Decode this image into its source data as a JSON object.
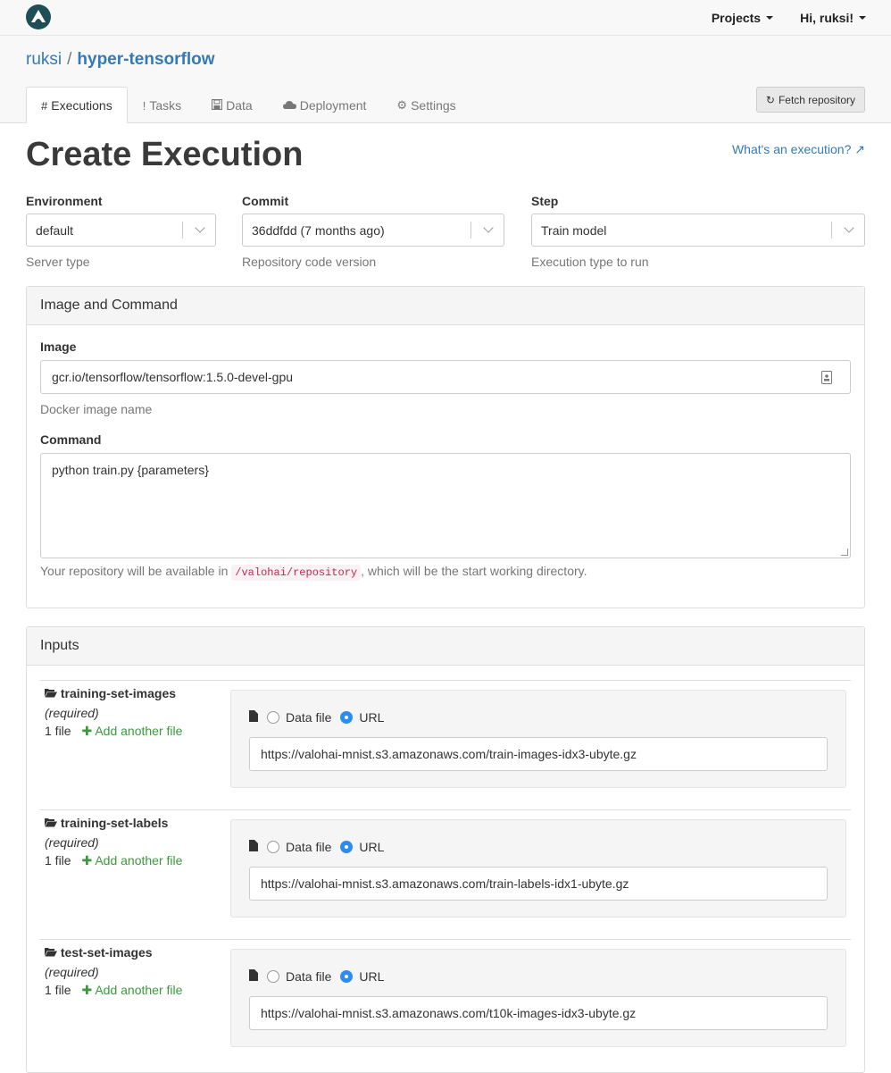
{
  "nav": {
    "projects_label": "Projects",
    "user_label": "Hi, ruksi!"
  },
  "breadcrumb": {
    "owner": "ruksi",
    "separator": "/",
    "repo": "hyper-tensorflow"
  },
  "tabs": [
    {
      "icon": "#",
      "label": "Executions",
      "active": true
    },
    {
      "icon": "!",
      "label": "Tasks",
      "active": false
    },
    {
      "icon": "💾",
      "label": "Data",
      "active": false
    },
    {
      "icon": "☁",
      "label": "Deployment",
      "active": false
    },
    {
      "icon": "⚙",
      "label": "Settings",
      "active": false
    }
  ],
  "fetch_button": {
    "icon": "↻",
    "label": "Fetch repository"
  },
  "page": {
    "title": "Create Execution",
    "help_link": "What's an execution? ↗"
  },
  "selectors": {
    "environment": {
      "label": "Environment",
      "value": "default",
      "help": "Server type"
    },
    "commit": {
      "label": "Commit",
      "value": "36ddfdd (7 months ago)",
      "help": "Repository code version"
    },
    "step": {
      "label": "Step",
      "value": "Train model",
      "help": "Execution type to run"
    }
  },
  "image_panel": {
    "heading": "Image and Command",
    "image_label": "Image",
    "image_value": "gcr.io/tensorflow/tensorflow:1.5.0-devel-gpu",
    "image_help": "Docker image name",
    "command_label": "Command",
    "command_value": "python train.py {parameters}",
    "repo_help_before": "Your repository will be available in",
    "repo_path": "/valohai/repository",
    "repo_help_after": ", which will be the start working directory."
  },
  "inputs_panel": {
    "heading": "Inputs",
    "items": [
      {
        "name": "training-set-images",
        "required": "(required)",
        "count": "1 file",
        "add": "Add another file",
        "opt_data": "Data file",
        "opt_url": "URL",
        "url": "https://valohai-mnist.s3.amazonaws.com/train-images-idx3-ubyte.gz"
      },
      {
        "name": "training-set-labels",
        "required": "(required)",
        "count": "1 file",
        "add": "Add another file",
        "opt_data": "Data file",
        "opt_url": "URL",
        "url": "https://valohai-mnist.s3.amazonaws.com/train-labels-idx1-ubyte.gz"
      },
      {
        "name": "test-set-images",
        "required": "(required)",
        "count": "1 file",
        "add": "Add another file",
        "opt_data": "Data file",
        "opt_url": "URL",
        "url": "https://valohai-mnist.s3.amazonaws.com/t10k-images-idx3-ubyte.gz"
      }
    ]
  }
}
